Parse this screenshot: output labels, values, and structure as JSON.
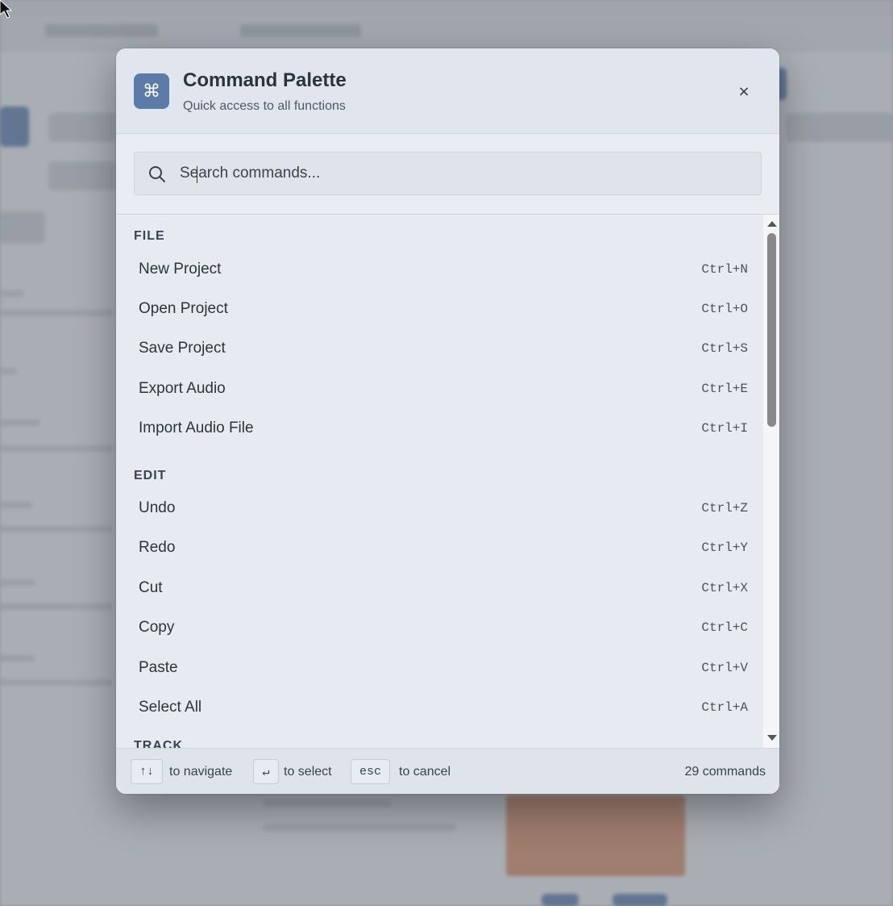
{
  "palette": {
    "logo_glyph": "⌘",
    "title": "Command Palette",
    "subtitle": "Quick access to all functions",
    "close_label": "×"
  },
  "search": {
    "placeholder": "Search commands...",
    "value": ""
  },
  "sections": [
    {
      "title": "FILE",
      "commands": [
        {
          "label": "New Project",
          "shortcut": "Ctrl+N"
        },
        {
          "label": "Open Project",
          "shortcut": "Ctrl+O"
        },
        {
          "label": "Save Project",
          "shortcut": "Ctrl+S"
        },
        {
          "label": "Export Audio",
          "shortcut": "Ctrl+E"
        },
        {
          "label": "Import Audio File",
          "shortcut": "Ctrl+I"
        }
      ]
    },
    {
      "title": "EDIT",
      "commands": [
        {
          "label": "Undo",
          "shortcut": "Ctrl+Z"
        },
        {
          "label": "Redo",
          "shortcut": "Ctrl+Y"
        },
        {
          "label": "Cut",
          "shortcut": "Ctrl+X"
        },
        {
          "label": "Copy",
          "shortcut": "Ctrl+C"
        },
        {
          "label": "Paste",
          "shortcut": "Ctrl+V"
        },
        {
          "label": "Select All",
          "shortcut": "Ctrl+A"
        }
      ]
    },
    {
      "title": "TRACK",
      "commands": []
    }
  ],
  "footer": {
    "navigate_key": "↑↓",
    "navigate_text": "to navigate",
    "select_key": "↵",
    "select_text": "to select",
    "cancel_key": "esc",
    "cancel_text": "to cancel",
    "count_text": "29 commands"
  },
  "colors": {
    "accent": "#5b7ba8",
    "panel_bg": "#e7ebf1"
  }
}
